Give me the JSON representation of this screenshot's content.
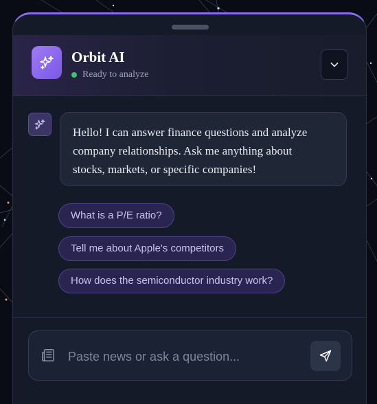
{
  "app": {
    "title": "Orbit AI",
    "status": "Ready to analyze",
    "accent_color": "#8b6cf0",
    "status_color": "#3ec46d"
  },
  "header": {
    "logo_icon": "sparkles-icon",
    "collapse_icon": "chevron-down-icon"
  },
  "messages": [
    {
      "role": "assistant",
      "avatar_icon": "sparkles-icon",
      "lines": [
        "Hello! I can answer finance questions and analyze",
        "company relationships. Ask me anything about",
        "stocks, markets, or specific companies!"
      ]
    }
  ],
  "suggestions": [
    "What is a P/E ratio?",
    "Tell me about Apple's competitors",
    "How does the semiconductor industry work?"
  ],
  "composer": {
    "placeholder": "Paste news or ask a question...",
    "value": "",
    "left_icon": "newspaper-icon",
    "send_icon": "send-icon"
  }
}
